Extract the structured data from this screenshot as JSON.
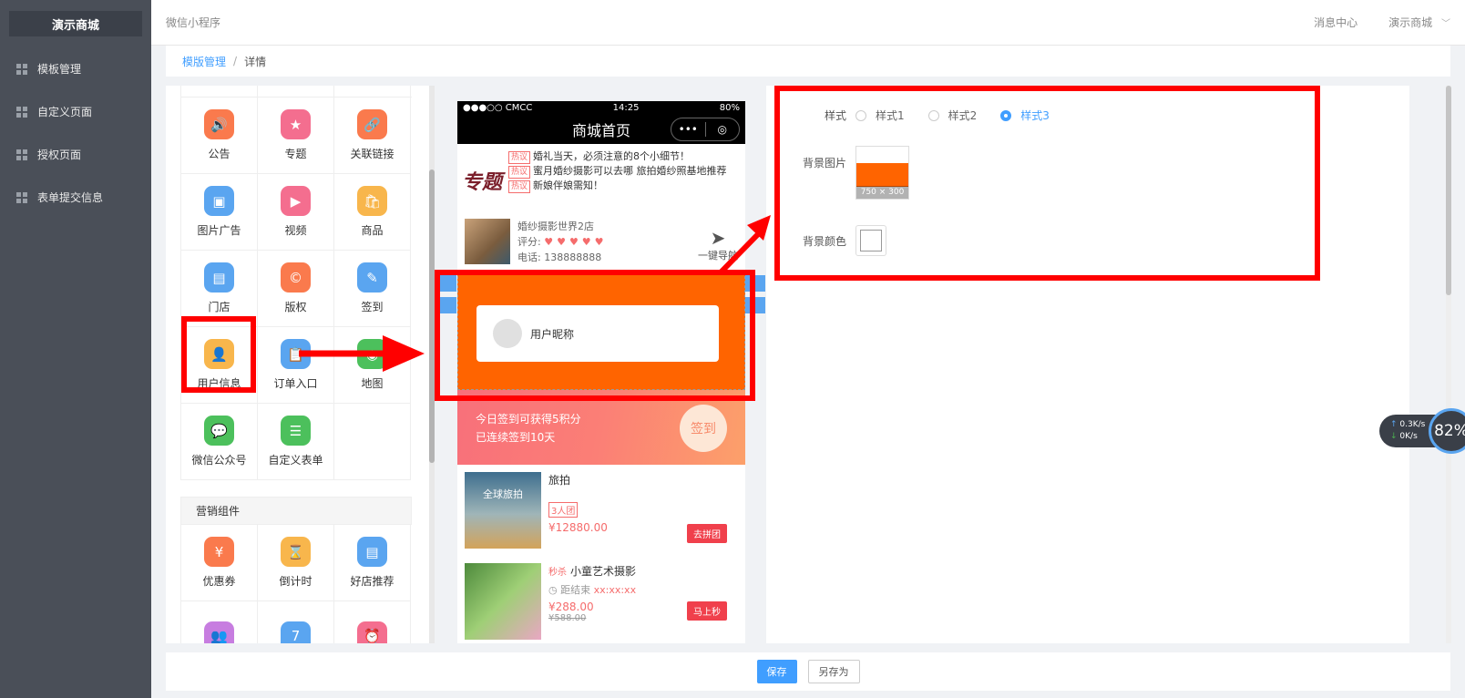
{
  "sidebar": {
    "brand": "演示商城",
    "items": [
      {
        "label": "模板管理"
      },
      {
        "label": "自定义页面"
      },
      {
        "label": "授权页面"
      },
      {
        "label": "表单提交信息"
      }
    ]
  },
  "topbar": {
    "title": "微信小程序",
    "messages": "消息中心",
    "account": "演示商城"
  },
  "breadcrumb": {
    "parent": "模版管理",
    "separator": "/",
    "current": "详情"
  },
  "components": {
    "basic": [
      {
        "label": "公告",
        "icon": "announcement-icon",
        "color": "#fa7a4d",
        "glyph": "🔊"
      },
      {
        "label": "专题",
        "icon": "topic-icon",
        "color": "#f46e8f",
        "glyph": "★"
      },
      {
        "label": "关联链接",
        "icon": "link-icon",
        "color": "#fa7a4d",
        "glyph": "🔗"
      },
      {
        "label": "图片广告",
        "icon": "image-ad-icon",
        "color": "#5aa5f0",
        "glyph": "▣"
      },
      {
        "label": "视频",
        "icon": "video-icon",
        "color": "#f46e8f",
        "glyph": "▶"
      },
      {
        "label": "商品",
        "icon": "goods-icon",
        "color": "#f8b64c",
        "glyph": "🛍"
      },
      {
        "label": "门店",
        "icon": "store-icon",
        "color": "#5aa5f0",
        "glyph": "▤"
      },
      {
        "label": "版权",
        "icon": "copyright-icon",
        "color": "#fa7a4d",
        "glyph": "©"
      },
      {
        "label": "签到",
        "icon": "checkin-icon",
        "color": "#5aa5f0",
        "glyph": "✎"
      },
      {
        "label": "用户信息",
        "icon": "user-info-icon",
        "color": "#f8b64c",
        "glyph": "👤"
      },
      {
        "label": "订单入口",
        "icon": "order-entry-icon",
        "color": "#5aa5f0",
        "glyph": "📋"
      },
      {
        "label": "地图",
        "icon": "map-icon",
        "color": "#4cc05c",
        "glyph": "◉"
      },
      {
        "label": "微信公众号",
        "icon": "wechat-icon",
        "color": "#4cc05c",
        "glyph": "💬"
      },
      {
        "label": "自定义表单",
        "icon": "custom-form-icon",
        "color": "#4cc05c",
        "glyph": "☰"
      }
    ],
    "marketing_title": "营销组件",
    "marketing": [
      {
        "label": "优惠券",
        "icon": "coupon-icon",
        "color": "#fa7a4d",
        "glyph": "¥"
      },
      {
        "label": "倒计时",
        "icon": "countdown-icon",
        "color": "#f8b64c",
        "glyph": "⌛"
      },
      {
        "label": "好店推荐",
        "icon": "shop-recommend-icon",
        "color": "#5aa5f0",
        "glyph": "▤"
      },
      {
        "label": "",
        "icon": "group-icon",
        "color": "#c77de0",
        "glyph": "👥"
      },
      {
        "label": "",
        "icon": "calendar-icon",
        "color": "#5aa5f0",
        "glyph": "7"
      },
      {
        "label": "",
        "icon": "alarm-icon",
        "color": "#f46e8f",
        "glyph": "⏰"
      }
    ]
  },
  "phone": {
    "status": {
      "carrier": "●●●○○ CMCC",
      "time": "14:25",
      "battery": "80%"
    },
    "nav_title": "商城首页",
    "capsule_more": "•••",
    "capsule_close": "◎",
    "topic": {
      "logo": "专题",
      "tag": "热议",
      "lines": [
        "婚礼当天，必须注意的8个小细节！",
        "蜜月婚纱摄影可以去哪 旅拍婚纱照基地推荐",
        "新娘伴娘需知！"
      ]
    },
    "store": {
      "name": "婚纱摄影世界2店",
      "rating_label": "评分:",
      "hearts": "♥♥♥♥♥",
      "phone": "电话: 138888888",
      "nav_label": "一键导航"
    },
    "user_card": {
      "nickname": "用户昵称"
    },
    "signin": {
      "line1": "今日签到可获得5积分",
      "line2": "已连续签到10天",
      "button": "签到"
    },
    "goods1": {
      "img_text": "全球旅拍",
      "title": "旅拍",
      "tag": "3人团",
      "price": "¥12880.00",
      "button": "去拼团"
    },
    "goods2": {
      "seckill": "秒杀",
      "title": "小童艺术摄影",
      "countdown_label": "距结束",
      "countdown": "xx:xx:xx",
      "price": "¥288.00",
      "old_price": "¥588.00",
      "button": "马上秒"
    }
  },
  "settings": {
    "style_label": "样式",
    "styles": [
      {
        "label": "样式1",
        "checked": false
      },
      {
        "label": "样式2",
        "checked": false
      },
      {
        "label": "样式3",
        "checked": true
      }
    ],
    "bg_image_label": "背景图片",
    "bg_image_size": "750 × 300",
    "bg_image_color": "#ff6400",
    "bg_color_label": "背景颜色",
    "bg_color_value": "#ffffff"
  },
  "footer": {
    "save": "保存",
    "save_as": "另存为"
  },
  "net_widget": {
    "up": "0.3K/s",
    "down": "0K/s",
    "percent": "82%"
  }
}
